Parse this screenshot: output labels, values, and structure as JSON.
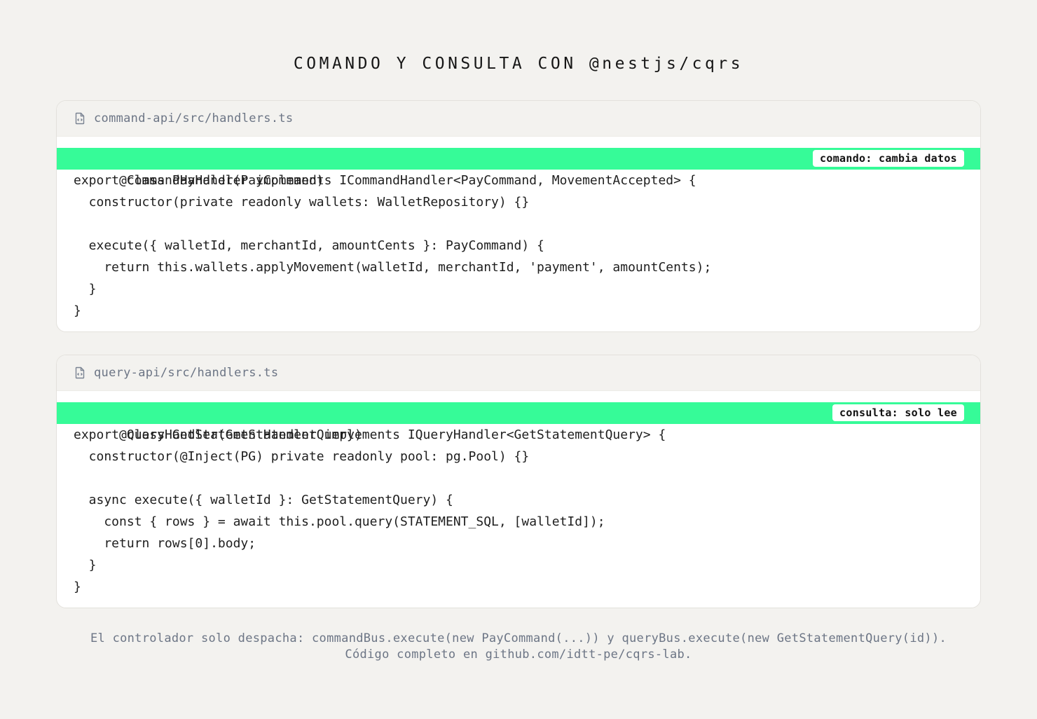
{
  "title": "COMANDO Y CONSULTA CON @nestjs/cqrs",
  "panels": {
    "command": {
      "file_icon": "file-code-icon",
      "path": "command-api/src/handlers.ts",
      "badge": "comando: cambia datos",
      "lines": [
        "@CommandHandler(PayCommand)",
        "export class PayHandler implements ICommandHandler<PayCommand, MovementAccepted> {",
        "  constructor(private readonly wallets: WalletRepository) {}",
        "",
        "  execute({ walletId, merchantId, amountCents }: PayCommand) {",
        "    return this.wallets.applyMovement(walletId, merchantId, 'payment', amountCents);",
        "  }",
        "}"
      ]
    },
    "query": {
      "file_icon": "file-code-icon",
      "path": "query-api/src/handlers.ts",
      "badge": "consulta: solo lee",
      "lines": [
        "@QueryHandler(GetStatementQuery)",
        "export class GetStatementHandler implements IQueryHandler<GetStatementQuery> {",
        "  constructor(@Inject(PG) private readonly pool: pg.Pool) {}",
        "",
        "  async execute({ walletId }: GetStatementQuery) {",
        "    const { rows } = await this.pool.query(STATEMENT_SQL, [walletId]);",
        "    return rows[0].body;",
        "  }",
        "}"
      ]
    }
  },
  "footer": {
    "line1": "El controlador solo despacha: commandBus.execute(new PayCommand(...)) y queryBus.execute(new GetStatementQuery(id)).",
    "line2": "Código completo en github.com/idtt-pe/cqrs-lab."
  },
  "colors": {
    "highlight": "#36fb98",
    "background": "#f3f2ef",
    "muted_text": "#6c7585"
  }
}
